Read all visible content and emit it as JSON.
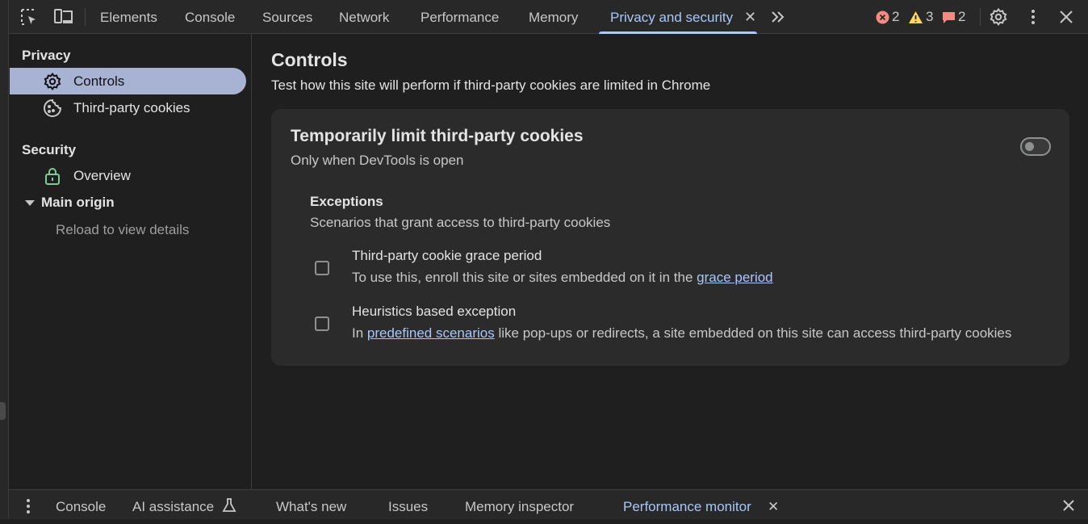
{
  "toolbar": {
    "tabs": [
      {
        "label": "Elements"
      },
      {
        "label": "Console"
      },
      {
        "label": "Sources"
      },
      {
        "label": "Network"
      },
      {
        "label": "Performance"
      },
      {
        "label": "Memory"
      },
      {
        "label": "Privacy and security",
        "active": true
      }
    ],
    "errors_count": "2",
    "warnings_count": "3",
    "issues_count": "2",
    "icons": [
      "inspect-element-icon",
      "device-toolbar-icon",
      "close-tab-icon",
      "more-tabs-icon",
      "error-icon",
      "warning-icon",
      "issue-icon",
      "settings-icon",
      "kebab-menu-icon",
      "close-icon"
    ],
    "accent_color": "#a8c7fa",
    "error_color": "#f28b82",
    "warning_color": "#fdd663"
  },
  "sidebar": {
    "privacy_heading": "Privacy",
    "privacy_items": [
      {
        "label": "Controls",
        "icon": "gear-icon",
        "selected": true
      },
      {
        "label": "Third-party cookies",
        "icon": "cookie-icon"
      }
    ],
    "security_heading": "Security",
    "security_items": [
      {
        "label": "Overview",
        "icon": "lock-icon"
      }
    ],
    "main_origin_label": "Main origin",
    "reload_text": "Reload to view details",
    "selected_color": "#a8b3d4",
    "lock_color": "#81c995"
  },
  "main": {
    "title": "Controls",
    "subtitle": "Test how this site will perform if third-party cookies are limited in Chrome",
    "card": {
      "title": "Temporarily limit third-party cookies",
      "subtitle": "Only when DevTools is open",
      "toggle_on": false,
      "exceptions_title": "Exceptions",
      "exceptions_subtitle": "Scenarios that grant access to third-party cookies",
      "rows": [
        {
          "title": "Third-party cookie grace period",
          "desc_prefix": "To use this, enroll this site or sites embedded on it in the ",
          "link": "grace period",
          "desc_suffix": "",
          "checked": false
        },
        {
          "title": "Heuristics based exception",
          "desc_prefix": "In ",
          "link": "predefined scenarios",
          "desc_suffix": " like pop-ups or redirects, a site embedded on this site can access third-party cookies",
          "checked": false
        }
      ]
    }
  },
  "drawer": {
    "tabs": [
      {
        "label": "Console"
      },
      {
        "label": "AI assistance",
        "icon": "flask-icon"
      },
      {
        "label": "What's new"
      },
      {
        "label": "Issues"
      },
      {
        "label": "Memory inspector"
      },
      {
        "label": "Performance monitor",
        "active": true
      }
    ],
    "icons": [
      "drawer-menu-icon",
      "close-tab-icon",
      "close-drawer-icon"
    ]
  }
}
